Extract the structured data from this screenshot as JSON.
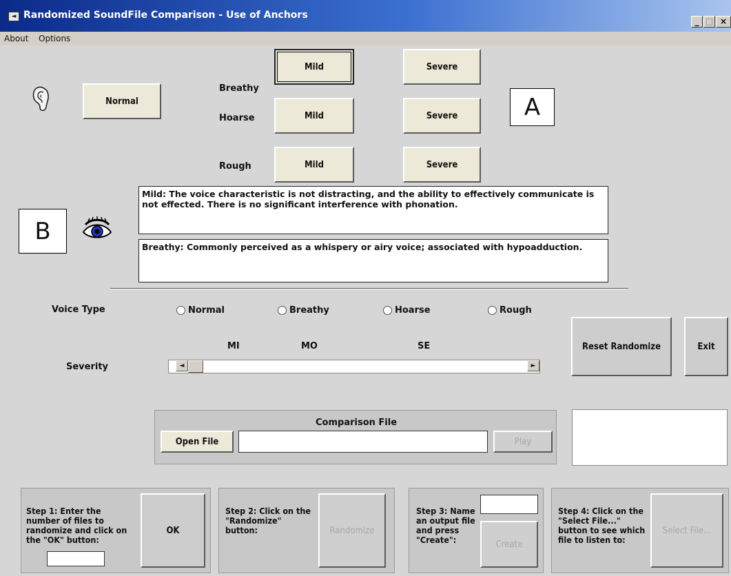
{
  "window": {
    "title": "Randomized SoundFile Comparison - Use of Anchors",
    "app_icon": "speaker-icon",
    "controls": [
      "_",
      "□",
      "×"
    ]
  },
  "menu": [
    "About",
    "Options"
  ],
  "anchors": {
    "normal_label": "Normal",
    "rows": [
      {
        "label": "Breathy",
        "mild": "Mild",
        "severe": "Severe"
      },
      {
        "label": "Hoarse",
        "mild": "Mild",
        "severe": "Severe"
      },
      {
        "label": "Rough",
        "mild": "Mild",
        "severe": "Severe"
      }
    ],
    "marker_a": "A",
    "marker_b": "B",
    "ear_icon": "ear-icon",
    "eye_icon": "eye-icon"
  },
  "descriptions": {
    "severity": "Mild: The voice characteristic is not distracting, and the ability to effectively communicate is not effected. There is no significant interference with phonation.",
    "type": "Breathy: Commonly perceived as a whispery or airy voice; associated with hypoadduction."
  },
  "voice_type": {
    "label": "Voice Type",
    "options": [
      "Normal",
      "Breathy",
      "Hoarse",
      "Rough"
    ]
  },
  "severity": {
    "label": "Severity",
    "ticks": [
      "MI",
      "MO",
      "SE"
    ],
    "scroll_value": 0
  },
  "buttons": {
    "reset": "Reset Randomize",
    "exit": "Exit"
  },
  "comparison": {
    "title": "Comparison File",
    "open": "Open File",
    "play": "Play",
    "file_value": ""
  },
  "steps": [
    {
      "text": "Step 1: Enter the number of files to randomize and click on the \"OK\" button:",
      "button": "OK"
    },
    {
      "text": "Step 2: Click on the \"Randomize\" button:",
      "button": "Randomize"
    },
    {
      "text": "Step 3: Name an output file and press \"Create\":",
      "button": "Create"
    },
    {
      "text": "Step 4: Click on the \"Select File...\" button to see which file to listen to:",
      "button": "Select File..."
    }
  ]
}
